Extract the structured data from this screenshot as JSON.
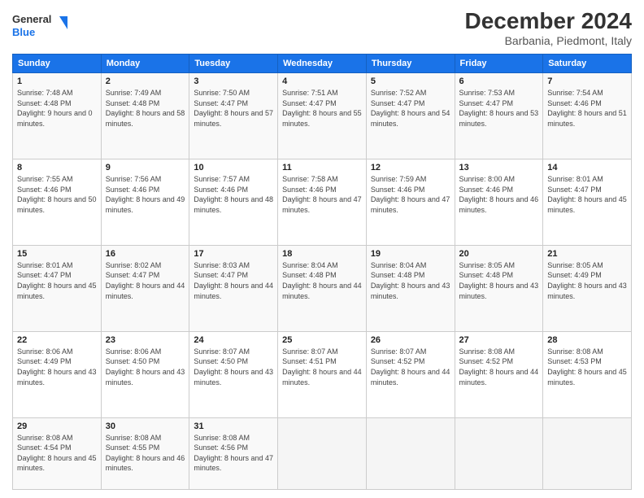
{
  "header": {
    "logo_line1": "General",
    "logo_line2": "Blue",
    "title": "December 2024",
    "subtitle": "Barbania, Piedmont, Italy"
  },
  "days_of_week": [
    "Sunday",
    "Monday",
    "Tuesday",
    "Wednesday",
    "Thursday",
    "Friday",
    "Saturday"
  ],
  "weeks": [
    [
      {
        "day": "1",
        "sunrise": "7:48 AM",
        "sunset": "4:48 PM",
        "daylight": "9 hours and 0 minutes."
      },
      {
        "day": "2",
        "sunrise": "7:49 AM",
        "sunset": "4:48 PM",
        "daylight": "8 hours and 58 minutes."
      },
      {
        "day": "3",
        "sunrise": "7:50 AM",
        "sunset": "4:47 PM",
        "daylight": "8 hours and 57 minutes."
      },
      {
        "day": "4",
        "sunrise": "7:51 AM",
        "sunset": "4:47 PM",
        "daylight": "8 hours and 55 minutes."
      },
      {
        "day": "5",
        "sunrise": "7:52 AM",
        "sunset": "4:47 PM",
        "daylight": "8 hours and 54 minutes."
      },
      {
        "day": "6",
        "sunrise": "7:53 AM",
        "sunset": "4:47 PM",
        "daylight": "8 hours and 53 minutes."
      },
      {
        "day": "7",
        "sunrise": "7:54 AM",
        "sunset": "4:46 PM",
        "daylight": "8 hours and 51 minutes."
      }
    ],
    [
      {
        "day": "8",
        "sunrise": "7:55 AM",
        "sunset": "4:46 PM",
        "daylight": "8 hours and 50 minutes."
      },
      {
        "day": "9",
        "sunrise": "7:56 AM",
        "sunset": "4:46 PM",
        "daylight": "8 hours and 49 minutes."
      },
      {
        "day": "10",
        "sunrise": "7:57 AM",
        "sunset": "4:46 PM",
        "daylight": "8 hours and 48 minutes."
      },
      {
        "day": "11",
        "sunrise": "7:58 AM",
        "sunset": "4:46 PM",
        "daylight": "8 hours and 47 minutes."
      },
      {
        "day": "12",
        "sunrise": "7:59 AM",
        "sunset": "4:46 PM",
        "daylight": "8 hours and 47 minutes."
      },
      {
        "day": "13",
        "sunrise": "8:00 AM",
        "sunset": "4:46 PM",
        "daylight": "8 hours and 46 minutes."
      },
      {
        "day": "14",
        "sunrise": "8:01 AM",
        "sunset": "4:47 PM",
        "daylight": "8 hours and 45 minutes."
      }
    ],
    [
      {
        "day": "15",
        "sunrise": "8:01 AM",
        "sunset": "4:47 PM",
        "daylight": "8 hours and 45 minutes."
      },
      {
        "day": "16",
        "sunrise": "8:02 AM",
        "sunset": "4:47 PM",
        "daylight": "8 hours and 44 minutes."
      },
      {
        "day": "17",
        "sunrise": "8:03 AM",
        "sunset": "4:47 PM",
        "daylight": "8 hours and 44 minutes."
      },
      {
        "day": "18",
        "sunrise": "8:04 AM",
        "sunset": "4:48 PM",
        "daylight": "8 hours and 44 minutes."
      },
      {
        "day": "19",
        "sunrise": "8:04 AM",
        "sunset": "4:48 PM",
        "daylight": "8 hours and 43 minutes."
      },
      {
        "day": "20",
        "sunrise": "8:05 AM",
        "sunset": "4:48 PM",
        "daylight": "8 hours and 43 minutes."
      },
      {
        "day": "21",
        "sunrise": "8:05 AM",
        "sunset": "4:49 PM",
        "daylight": "8 hours and 43 minutes."
      }
    ],
    [
      {
        "day": "22",
        "sunrise": "8:06 AM",
        "sunset": "4:49 PM",
        "daylight": "8 hours and 43 minutes."
      },
      {
        "day": "23",
        "sunrise": "8:06 AM",
        "sunset": "4:50 PM",
        "daylight": "8 hours and 43 minutes."
      },
      {
        "day": "24",
        "sunrise": "8:07 AM",
        "sunset": "4:50 PM",
        "daylight": "8 hours and 43 minutes."
      },
      {
        "day": "25",
        "sunrise": "8:07 AM",
        "sunset": "4:51 PM",
        "daylight": "8 hours and 44 minutes."
      },
      {
        "day": "26",
        "sunrise": "8:07 AM",
        "sunset": "4:52 PM",
        "daylight": "8 hours and 44 minutes."
      },
      {
        "day": "27",
        "sunrise": "8:08 AM",
        "sunset": "4:52 PM",
        "daylight": "8 hours and 44 minutes."
      },
      {
        "day": "28",
        "sunrise": "8:08 AM",
        "sunset": "4:53 PM",
        "daylight": "8 hours and 45 minutes."
      }
    ],
    [
      {
        "day": "29",
        "sunrise": "8:08 AM",
        "sunset": "4:54 PM",
        "daylight": "8 hours and 45 minutes."
      },
      {
        "day": "30",
        "sunrise": "8:08 AM",
        "sunset": "4:55 PM",
        "daylight": "8 hours and 46 minutes."
      },
      {
        "day": "31",
        "sunrise": "8:08 AM",
        "sunset": "4:56 PM",
        "daylight": "8 hours and 47 minutes."
      },
      null,
      null,
      null,
      null
    ]
  ]
}
